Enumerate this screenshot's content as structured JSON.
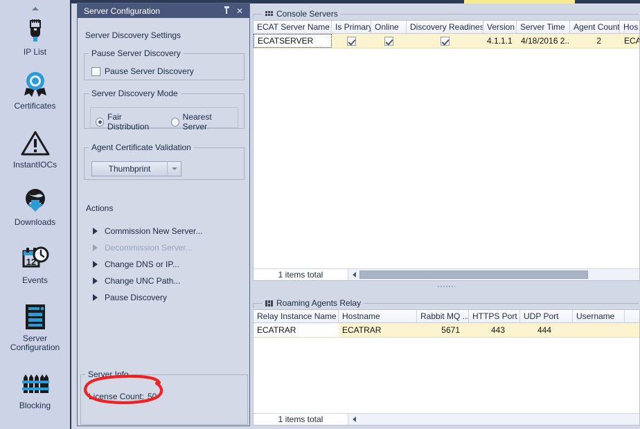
{
  "sidebar": {
    "scroll_up": "scroll-up",
    "items": [
      {
        "label": "IP List",
        "icon": "network-plug-icon"
      },
      {
        "label": "Certificates",
        "icon": "certificate-rosette-icon"
      },
      {
        "label": "InstantIOCs",
        "icon": "warning-triangle-icon"
      },
      {
        "label": "Downloads",
        "icon": "globe-download-icon"
      },
      {
        "label": "Events",
        "icon": "calendar-clock-icon"
      },
      {
        "label": "Server\nConfiguration",
        "icon": "server-rack-icon"
      },
      {
        "label": "Blocking",
        "icon": "fence-icon"
      }
    ]
  },
  "panel": {
    "title": "Server Configuration",
    "pin_tooltip": "Auto Hide",
    "close_tooltip": "Close",
    "heading": "Server Discovery Settings",
    "pause_group": {
      "legend": "Pause Server Discovery",
      "checkbox_label": "Pause Server Discovery",
      "checked": false
    },
    "mode_group": {
      "legend": "Server Discovery Mode",
      "options": [
        {
          "label": "Fair Distribution",
          "selected": true
        },
        {
          "label": "Nearest Server",
          "selected": false
        }
      ]
    },
    "cert_group": {
      "legend": "Agent Certificate Validation",
      "selected": "Thumbprint"
    },
    "actions_heading": "Actions",
    "actions": [
      {
        "label": "Commission New Server...",
        "enabled": true
      },
      {
        "label": "Decommission Server...",
        "enabled": false
      },
      {
        "label": "Change DNS or IP...",
        "enabled": true
      },
      {
        "label": "Change UNC Path...",
        "enabled": true
      },
      {
        "label": "Pause Discovery",
        "enabled": true
      }
    ],
    "server_info": {
      "legend": "Server Info",
      "license_label": "License Count:",
      "license_value": "50"
    }
  },
  "annotation": {
    "shape": "red-ellipse",
    "color": "#ee2222",
    "target": "License Count: 50"
  },
  "console_servers": {
    "caption": "Console Servers",
    "columns": [
      "ECAT Server Name",
      "Is Primary",
      "Online",
      "Discovery Readiness",
      "Version",
      "Server Time",
      "Agent Count",
      "Hos"
    ],
    "rows": [
      {
        "ecat_server_name": "ECATSERVER",
        "is_primary": true,
        "online": true,
        "discovery_readiness": true,
        "version": "4.1.1.1",
        "server_time": "4/18/2016 2...",
        "agent_count": "2",
        "hostname": "ECA"
      }
    ],
    "footer": "1 items total"
  },
  "roaming_relay": {
    "caption": "Roaming Agents Relay",
    "columns": [
      "Relay Instance Name",
      "Hostname",
      "Rabbit MQ ...",
      "HTTPS Port",
      "UDP Port",
      "Username",
      ""
    ],
    "rows": [
      {
        "relay_instance_name": "ECATRAR",
        "hostname": "ECATRAR",
        "rabbit_mq": "5671",
        "https_port": "443",
        "udp_port": "444",
        "username": "",
        "blank": ""
      }
    ],
    "footer": "1 items total"
  },
  "colors": {
    "accent_blue": "#2d9bd6",
    "panel_title_bg": "#47567a",
    "row_highlight": "#fcf3cf",
    "annotation_red": "#ee2222",
    "chrome_dark": "#2c3a55"
  }
}
